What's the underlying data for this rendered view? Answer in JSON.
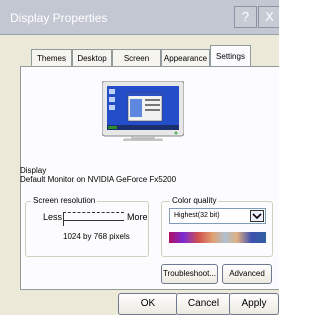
{
  "window": {
    "title": "Display Properties"
  },
  "title_buttons": {
    "help": "?",
    "close": "X"
  },
  "tabs": [
    {
      "label": "Themes"
    },
    {
      "label": "Desktop"
    },
    {
      "label": "Screen Saver"
    },
    {
      "label": "Appearance"
    },
    {
      "label": "Settings"
    }
  ],
  "display": {
    "label": "Display",
    "value": "Default Monitor on NVIDIA  GeForce Fx5200"
  },
  "screen_resolution": {
    "label": "Screen resolution",
    "less": "Less",
    "more": "More",
    "value_text": "1024 by 768 pixels"
  },
  "color_quality": {
    "label": "Color quality",
    "selected": "Highest(32 bit)"
  },
  "buttons": {
    "troubleshoot": "Troubleshoot...",
    "advanced": "Advanced",
    "ok": "OK",
    "cancel": "Cancel",
    "apply": "Apply"
  },
  "colors": {
    "titlebar": "#c2c7d2",
    "dialog_bg": "#ece9d8",
    "panel_bg": "#fcfcfe"
  }
}
